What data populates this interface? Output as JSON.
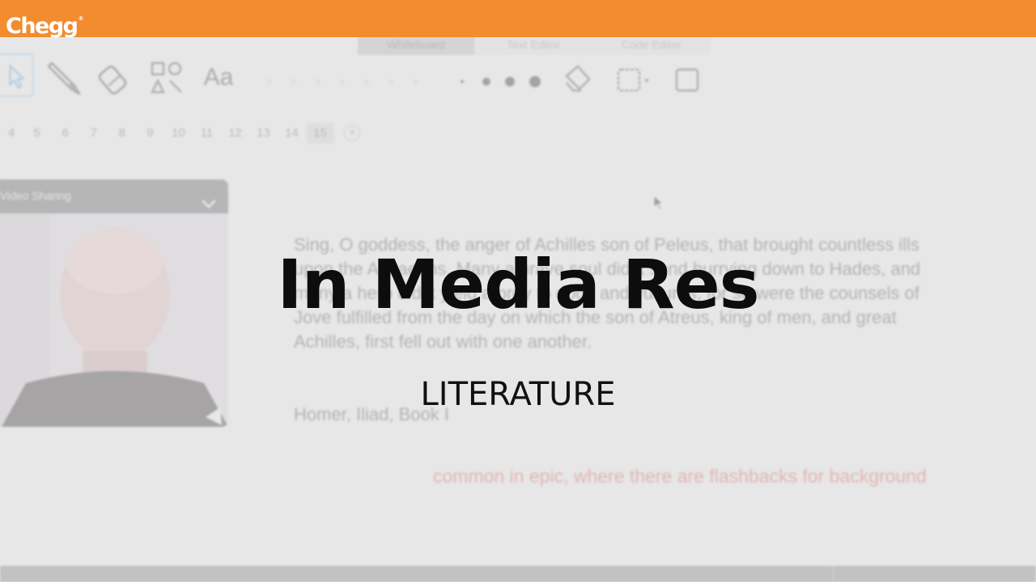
{
  "brand": {
    "logo_text": "Chegg",
    "registered_mark": "®",
    "bar_color": "#f28c2e"
  },
  "toolbar": {
    "mode_tabs": [
      "Whiteboard",
      "Text Editor",
      "Code Editor"
    ],
    "active_mode": "Whiteboard",
    "font_tool_label": "Aa",
    "tool_icons": [
      "select-cursor-icon",
      "pencil-icon",
      "eraser-icon",
      "shapes-icon",
      "text-icon",
      "stroke-size-icon",
      "fill-icon",
      "grid-icon",
      "frame-icon"
    ]
  },
  "pages": {
    "numbers": [
      "4",
      "5",
      "6",
      "7",
      "8",
      "9",
      "10",
      "11",
      "12",
      "13",
      "14",
      "15"
    ],
    "current": "15",
    "add_label": "+"
  },
  "video_panel": {
    "title": "Video Sharing"
  },
  "document": {
    "passage": "Sing, O goddess, the anger of Achilles son of Peleus, that brought countless ills upon the Achaeans. Many a brave soul did it send hurrying down to Hades, and many a hero did it yield a prey to dogs and vultures, for so were the counsels of Jove fulfilled from the day on which the son of Atreus, king of men, and great Achilles, first fell out with one another.",
    "citation": "Homer, Iliad, Book I",
    "annotation": "common in epic, where there are flashbacks for background",
    "annotation_color": "#d9696b"
  },
  "overlay": {
    "title": "In Media Res",
    "subtitle": "LITERATURE"
  }
}
